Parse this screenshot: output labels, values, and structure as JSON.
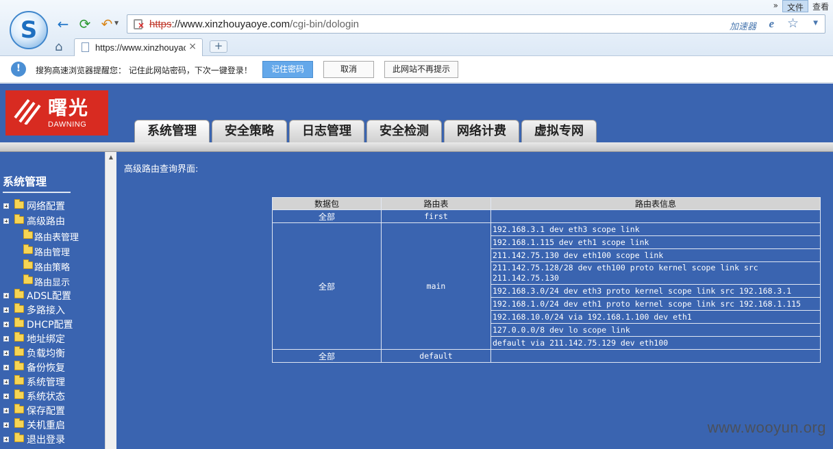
{
  "browser": {
    "top_menu": {
      "more": "»",
      "file": "文件",
      "view": "查看"
    },
    "url_protocol": "https",
    "url_domain": "://www.xinzhouyaoye.com",
    "url_path": "/cgi-bin/dologin",
    "speed_label": "加速器",
    "tab_title": "https://www.xinzhouyaoye.com",
    "new_tab_label": "+"
  },
  "notification": {
    "text": "搜狗高速浏览器提醒您： 记住此网站密码，下次一键登录！",
    "remember_label": "记住密码",
    "cancel_label": "取消",
    "never_label": "此网站不再提示"
  },
  "app": {
    "brand_name": "曙光",
    "brand_sub": "DAWNING",
    "main_tabs": [
      "系统管理",
      "安全策略",
      "日志管理",
      "安全检测",
      "网络计费",
      "虚拟专网"
    ],
    "sidebar": {
      "title": "系统管理",
      "items": [
        "网络配置",
        "高级路由",
        "ADSL配置",
        "多路接入",
        "DHCP配置",
        "地址绑定",
        "负载均衡",
        "备份恢复",
        "系统管理",
        "系统状态",
        "保存配置",
        "关机重启",
        "退出登录"
      ],
      "sub_items": [
        "路由表管理",
        "路由管理",
        "路由策略",
        "路由显示"
      ]
    },
    "content_title": "高级路由查询界面:",
    "table": {
      "headers": [
        "数据包",
        "路由表",
        "路由表信息"
      ],
      "rows": [
        {
          "packet": "全部",
          "table": "first",
          "info": [
            ""
          ]
        },
        {
          "packet": "全部",
          "table": "main",
          "info": [
            "192.168.3.1 dev eth3 scope link",
            "192.168.1.115 dev eth1 scope link",
            "211.142.75.130 dev eth100 scope link",
            "211.142.75.128/28 dev eth100 proto kernel scope link src 211.142.75.130",
            "192.168.3.0/24 dev eth3 proto kernel scope link src 192.168.3.1",
            "192.168.1.0/24 dev eth1 proto kernel scope link src 192.168.1.115",
            "192.168.10.0/24 via 192.168.1.100 dev eth1",
            "127.0.0.0/8 dev lo scope link",
            "default via 211.142.75.129 dev eth100"
          ]
        },
        {
          "packet": "全部",
          "table": "default",
          "info": [
            ""
          ]
        }
      ]
    }
  },
  "watermark": "www.wooyun.org"
}
